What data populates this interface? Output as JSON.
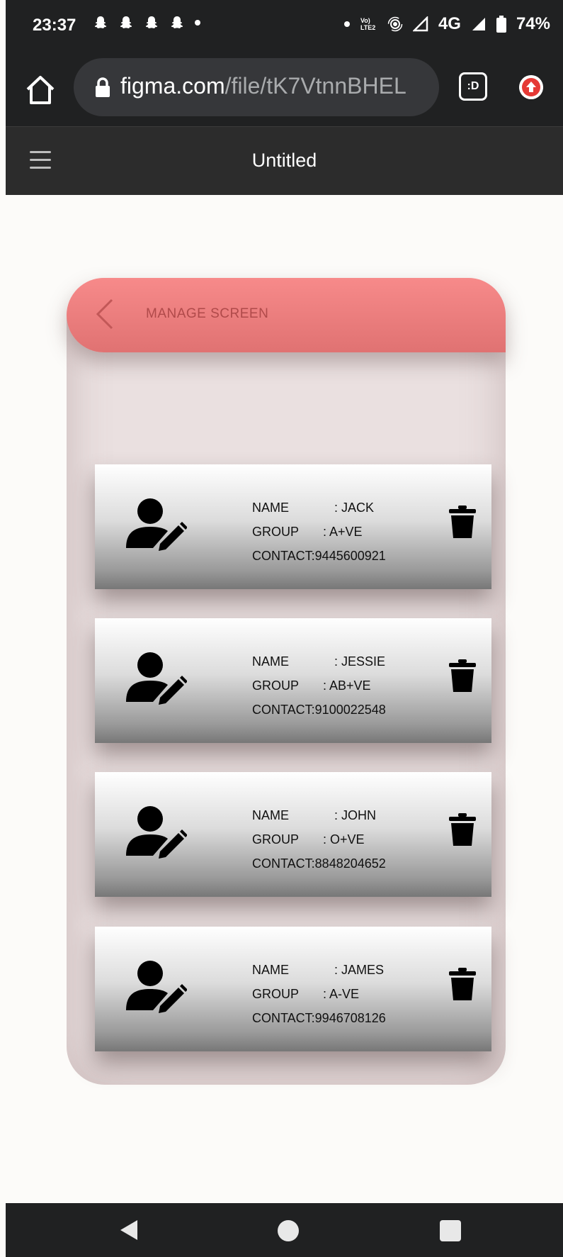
{
  "status_bar": {
    "time": "23:37",
    "network": "4G",
    "battery": "74%",
    "volte": "Vo) LTE2"
  },
  "browser": {
    "url_host": "figma.com",
    "url_path": "/file/tK7VtnnBHEL",
    "tabs_label": ":D"
  },
  "figma": {
    "file_title": "Untitled"
  },
  "screen": {
    "header_title": "MANAGE SCREEN",
    "accent_color": "#f08080",
    "donors": [
      {
        "name_label": "NAME",
        "name": ": JACK",
        "group_label": "GROUP",
        "group": ": A+VE",
        "contact_label": "CONTACT:",
        "contact": "9445600921"
      },
      {
        "name_label": "NAME",
        "name": ": JESSIE",
        "group_label": "GROUP",
        "group": ": AB+VE",
        "contact_label": "CONTACT:",
        "contact": "9100022548"
      },
      {
        "name_label": "NAME",
        "name": ": JOHN",
        "group_label": "GROUP",
        "group": ": O+VE",
        "contact_label": "CONTACT:",
        "contact": "8848204652"
      },
      {
        "name_label": "NAME",
        "name": ": JAMES",
        "group_label": "GROUP",
        "group": ": A-VE",
        "contact_label": "CONTACT:",
        "contact": "9946708126"
      }
    ]
  },
  "icons": [
    "home-icon",
    "lock-icon",
    "tabs-icon",
    "update-icon",
    "menu-icon",
    "back-chevron-icon",
    "user-edit-icon",
    "trash-icon",
    "nav-back-icon",
    "nav-home-icon",
    "nav-recents-icon"
  ]
}
